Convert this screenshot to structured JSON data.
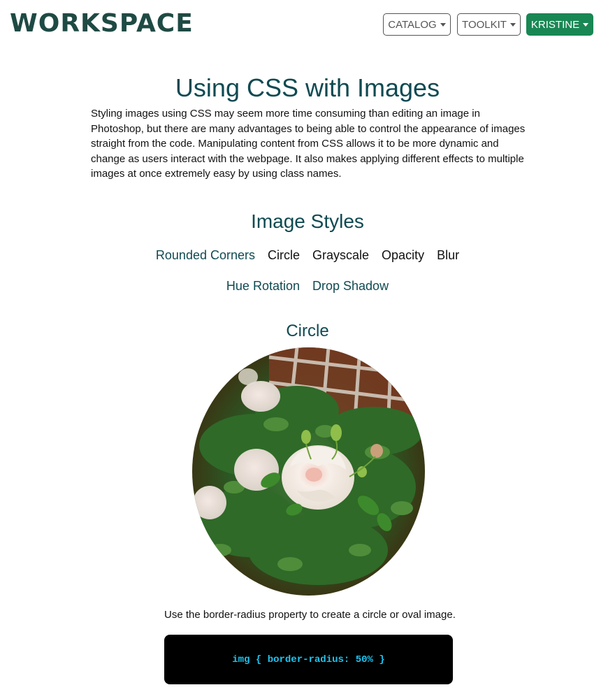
{
  "header": {
    "logo": "WORKSPACE",
    "nav": [
      {
        "label": "CATALOG"
      },
      {
        "label": "TOOLKIT"
      },
      {
        "label": "KRISTINE"
      }
    ]
  },
  "main": {
    "title": "Using CSS with Images",
    "intro": "Styling images using CSS may seem more time consuming than editing an image in Photoshop, but there are many advantages to being able to control the appearance of images straight from the code. Manipulating content from CSS allows it to be more dynamic and change as users interact with the webpage. It also makes applying different effects to multiple images at once extremely easy by using class names.",
    "styles_heading": "Image Styles",
    "style_links": [
      "Rounded Corners",
      "Circle",
      "Grayscale",
      "Opacity",
      "Blur",
      "Hue Rotation",
      "Drop Shadow"
    ],
    "section": {
      "heading": "Circle",
      "caption": "Use the border-radius property to create a circle or oval image.",
      "code": "img { border-radius: 50% }"
    }
  },
  "colors": {
    "brand": "#1f4a44",
    "heading": "#0f4a52",
    "primary_button": "#198754",
    "code_text": "#1cc4ef"
  }
}
